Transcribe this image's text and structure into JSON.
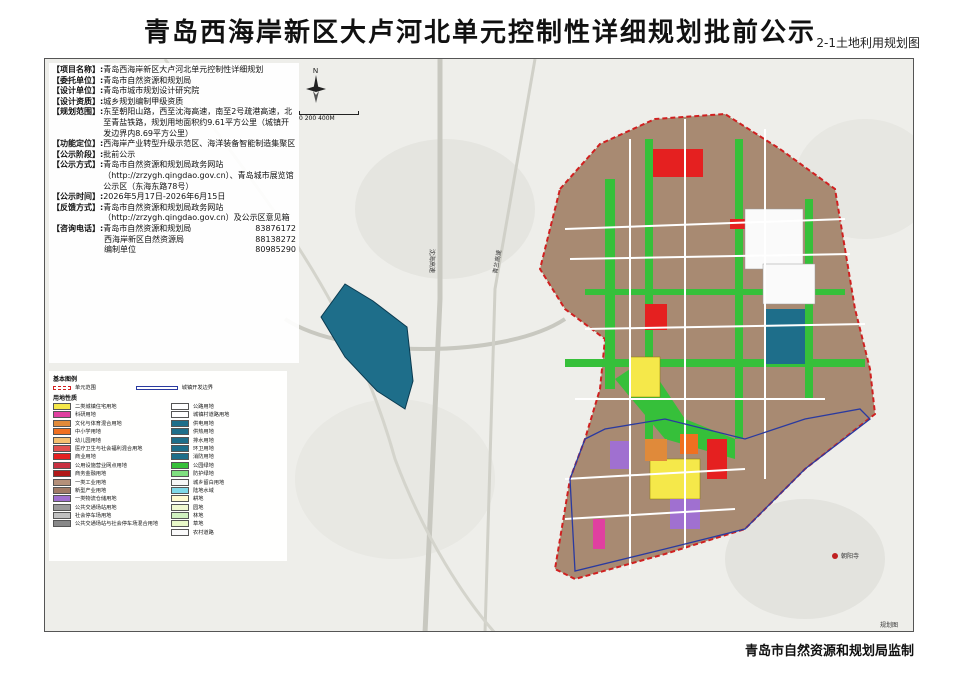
{
  "title": "青岛西海岸新区大卢河北单元控制性详细规划批前公示",
  "subtitle": "2-1土地利用规划图",
  "footer": "青岛市自然资源和规划局监制",
  "info": [
    {
      "key": "【项目名称】:",
      "val": "青岛西海岸新区大卢河北单元控制性详细规划"
    },
    {
      "key": "【委托单位】:",
      "val": "青岛市自然资源和规划局"
    },
    {
      "key": "【设计单位】:",
      "val": "青岛市城市规划设计研究院"
    },
    {
      "key": "【设计资质】:",
      "val": "城乡规划编制甲级资质"
    },
    {
      "key": "【规划范围】:",
      "val": "东至朝阳山路，西至沈海高速，南至2号疏港高速，北至青盐铁路，规划用地面积约9.61平方公里（城镇开发边界内8.69平方公里）"
    },
    {
      "key": "【功能定位】:",
      "val": "西海岸产业转型升级示范区、海洋装备智能制造集聚区"
    },
    {
      "key": "【公示阶段】:",
      "val": "批前公示"
    },
    {
      "key": "【公示方式】:",
      "val": "青岛市自然资源和规划局政务网站（http://zrzygh.qingdao.gov.cn）、青岛城市展览馆公示区（东海东路78号）"
    },
    {
      "key": "【公示时间】:",
      "val": "2026年5月17日-2026年6月15日"
    },
    {
      "key": "【反馈方式】:",
      "val": "青岛市自然资源和规划局政务网站（http://zrzygh.qingdao.gov.cn）及公示区意见箱"
    }
  ],
  "contacts_label": "【咨询电话】:",
  "contacts": [
    {
      "name": "青岛市自然资源和规划局",
      "phone": "83876172"
    },
    {
      "name": "西海岸新区自然资源局",
      "phone": "88138272"
    },
    {
      "name": "编制单位",
      "phone": "80985290"
    }
  ],
  "compass_label": "N",
  "scale_label": "0  200  400M",
  "legend": {
    "title": "基本图例",
    "boundary_planning": "单元范围",
    "boundary_urban": "城镇开发边界",
    "landuse_title": "用地性质",
    "items": [
      {
        "label": "二类城镇住宅用地",
        "color": "#f5e84a",
        "left": true
      },
      {
        "label": "科研用地",
        "color": "#e040a0",
        "left": true
      },
      {
        "label": "文化与体育混合用地",
        "color": "#e08a3a",
        "left": true
      },
      {
        "label": "中小学用地",
        "color": "#f07020",
        "left": true
      },
      {
        "label": "幼儿园用地",
        "color": "#f5c070",
        "left": true
      },
      {
        "label": "医疗卫生与社会福利混合用地",
        "color": "#e05050",
        "left": true
      },
      {
        "label": "商业用地",
        "color": "#e52020",
        "left": true
      },
      {
        "label": "公用设施营业网点用地",
        "color": "#c83040",
        "left": true
      },
      {
        "label": "商务金融用地",
        "color": "#b01818",
        "left": true
      },
      {
        "label": "一类工业用地",
        "color": "#b4907a",
        "left": true
      },
      {
        "label": "新型产业用地",
        "color": "#a07a66",
        "left": true
      },
      {
        "label": "一类物流仓储用地",
        "color": "#a070d0",
        "left": true
      },
      {
        "label": "公共交通场站用地",
        "color": "#9a9a9a",
        "left": true
      },
      {
        "label": "社会停车场用地",
        "color": "#c0c0c0",
        "left": true
      },
      {
        "label": "公共交通场站与社会停车场混合用地",
        "color": "#888888",
        "left": true
      },
      {
        "label": "公路用地",
        "color": "#ffffff",
        "left": false
      },
      {
        "label": "城镇村道路用地",
        "color": "#ffffff",
        "left": false
      },
      {
        "label": "供电用地",
        "color": "#1e6e8a",
        "left": false
      },
      {
        "label": "供热用地",
        "color": "#1e6e8a",
        "left": false
      },
      {
        "label": "排水用地",
        "color": "#1e6e8a",
        "left": false
      },
      {
        "label": "环卫用地",
        "color": "#1e6e8a",
        "left": false
      },
      {
        "label": "消防用地",
        "color": "#1e6e8a",
        "left": false
      },
      {
        "label": "公园绿地",
        "color": "#36c03a",
        "left": false
      },
      {
        "label": "防护绿地",
        "color": "#80e080",
        "left": false
      },
      {
        "label": "城乡留白用地",
        "color": "#f6f6f6",
        "left": false
      },
      {
        "label": "陆地水域",
        "color": "#7fd8e8",
        "left": false
      },
      {
        "label": "耕地",
        "color": "#fffad0",
        "left": false
      },
      {
        "label": "园地",
        "color": "#f0f8d0",
        "left": false
      },
      {
        "label": "林地",
        "color": "#d0f0c0",
        "left": false
      },
      {
        "label": "草地",
        "color": "#e8f8c8",
        "left": false
      },
      {
        "label": "农村道路",
        "color": "#fafafa",
        "left": false
      }
    ]
  },
  "map_labels": {
    "road_shenhai": "沈海高速",
    "road_other": "青兰高速",
    "village": "朝阳寺",
    "corner": "规划图"
  },
  "colors": {
    "industrial": "#a88a72",
    "green": "#36c03a",
    "residential": "#f5e84a",
    "commercial": "#e52020",
    "utility": "#1e6e8a",
    "boundary_red": "#d02020",
    "boundary_blue": "#2a3aa0"
  }
}
